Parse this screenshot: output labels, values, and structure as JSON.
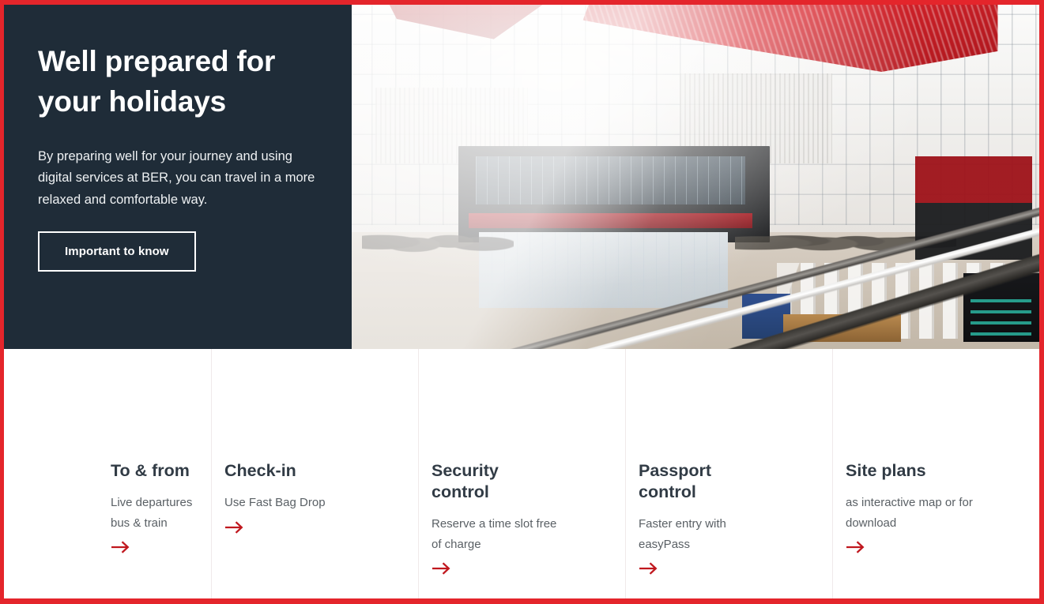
{
  "theme": {
    "border_red": "#E4252B",
    "panel_navy": "#1F2C38",
    "arrow_red": "#C0171E",
    "heading_slate": "#313B45",
    "body_gray": "#5A6065",
    "divider": "#F0E9EA"
  },
  "hero": {
    "title": "Well prepared for your holidays",
    "subtitle": "By preparing well for your journey and using digital services at BER, you can travel in a more relaxed and comfortable way.",
    "button_label": "Important to know",
    "image_alt": "BER airport terminal departure hall with travellers, check-in kiosks and red directional signage"
  },
  "cards": [
    {
      "title": "To & from",
      "description": "Live departures bus & train",
      "arrow_icon": "arrow-right-icon"
    },
    {
      "title": "Check-in",
      "description": "Use Fast Bag Drop",
      "arrow_icon": "arrow-right-icon"
    },
    {
      "title": "Security control",
      "description": "Reserve a time slot free of charge",
      "arrow_icon": "arrow-right-icon"
    },
    {
      "title": "Passport control",
      "description": "Faster entry with easyPass",
      "arrow_icon": "arrow-right-icon"
    },
    {
      "title": "Site plans",
      "description": "as interactive map or for download",
      "arrow_icon": "arrow-right-icon"
    }
  ]
}
